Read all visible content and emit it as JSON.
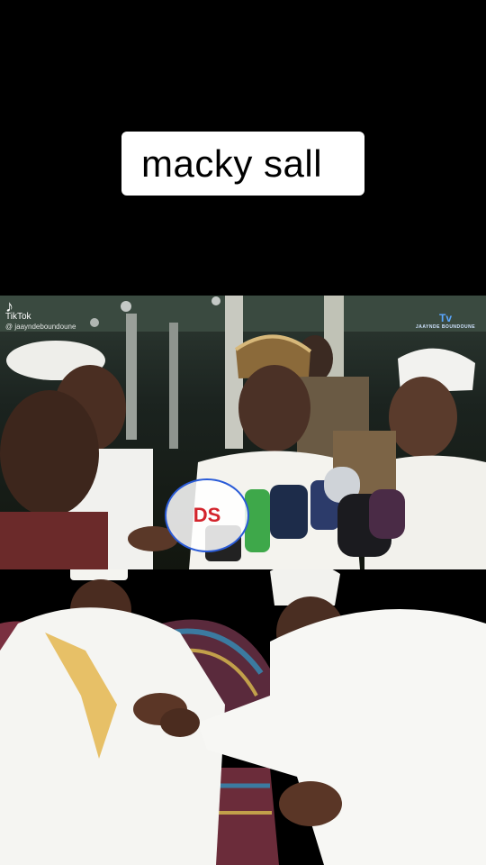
{
  "caption": "macky sall",
  "watermark": {
    "app": "TikTok",
    "user": "@ jaayndeboundoune"
  },
  "broadcast_logo": {
    "label": "Tv",
    "tagline": "JAAYNDE BOUNDOUNE"
  },
  "mic_badge": "DS"
}
